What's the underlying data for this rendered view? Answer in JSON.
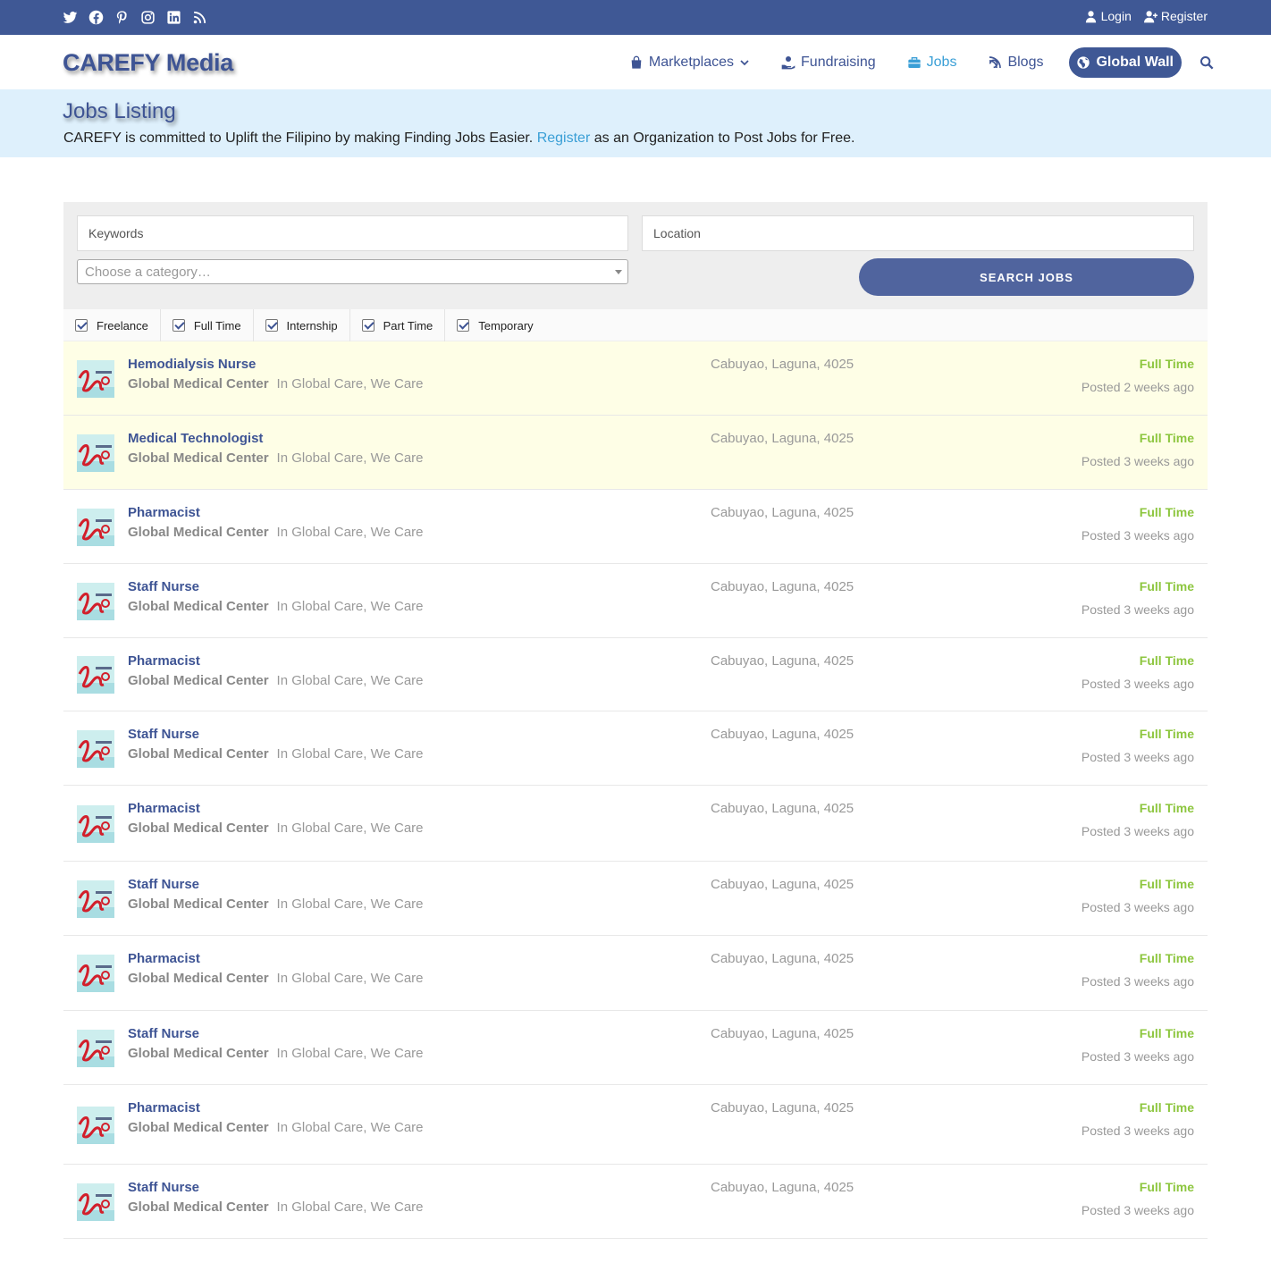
{
  "topbar": {
    "social": [
      "twitter-icon",
      "facebook-icon",
      "pinterest-icon",
      "instagram-icon",
      "linkedin-icon",
      "rss-icon"
    ],
    "login": "Login",
    "register": "Register"
  },
  "header": {
    "logo": "CAREFY Media",
    "nav": {
      "marketplaces": "Marketplaces",
      "fundraising": "Fundraising",
      "jobs": "Jobs",
      "blogs": "Blogs",
      "global_wall": "Global Wall"
    }
  },
  "banner": {
    "title": "Jobs Listing",
    "text_before": "CAREFY is committed to Uplift the Filipino by making Finding Jobs Easier. ",
    "link": "Register",
    "text_after": " as an Organization to Post Jobs for Free."
  },
  "search": {
    "keywords_placeholder": "Keywords",
    "location_placeholder": "Location",
    "category_placeholder": "Choose a category…",
    "button": "SEARCH JOBS"
  },
  "job_types": [
    "Freelance",
    "Full Time",
    "Internship",
    "Part Time",
    "Temporary"
  ],
  "colors": {
    "brand": "#3f5895",
    "accent": "#3a9fd6",
    "fulltime": "#8dc63f",
    "featured_bg": "#fefee6"
  },
  "jobs": [
    {
      "title": "Hemodialysis Nurse",
      "company": "Global Medical Center",
      "tagline": "In Global Care, We Care",
      "location": "Cabuyao, Laguna, 4025",
      "type": "Full Time",
      "posted": "Posted 2 weeks ago",
      "featured": true
    },
    {
      "title": "Medical Technologist",
      "company": "Global Medical Center",
      "tagline": "In Global Care, We Care",
      "location": "Cabuyao, Laguna, 4025",
      "type": "Full Time",
      "posted": "Posted 3 weeks ago",
      "featured": true
    },
    {
      "title": "Pharmacist",
      "company": "Global Medical Center",
      "tagline": "In Global Care, We Care",
      "location": "Cabuyao, Laguna, 4025",
      "type": "Full Time",
      "posted": "Posted 3 weeks ago",
      "featured": false
    },
    {
      "title": "Staff Nurse",
      "company": "Global Medical Center",
      "tagline": "In Global Care, We Care",
      "location": "Cabuyao, Laguna, 4025",
      "type": "Full Time",
      "posted": "Posted 3 weeks ago",
      "featured": false
    },
    {
      "title": "Pharmacist",
      "company": "Global Medical Center",
      "tagline": "In Global Care, We Care",
      "location": "Cabuyao, Laguna, 4025",
      "type": "Full Time",
      "posted": "Posted 3 weeks ago",
      "featured": false
    },
    {
      "title": "Staff Nurse",
      "company": "Global Medical Center",
      "tagline": "In Global Care, We Care",
      "location": "Cabuyao, Laguna, 4025",
      "type": "Full Time",
      "posted": "Posted 3 weeks ago",
      "featured": false
    },
    {
      "title": "Pharmacist",
      "company": "Global Medical Center",
      "tagline": "In Global Care, We Care",
      "location": "Cabuyao, Laguna, 4025",
      "type": "Full Time",
      "posted": "Posted 3 weeks ago",
      "featured": false
    },
    {
      "title": "Staff Nurse",
      "company": "Global Medical Center",
      "tagline": "In Global Care, We Care",
      "location": "Cabuyao, Laguna, 4025",
      "type": "Full Time",
      "posted": "Posted 3 weeks ago",
      "featured": false
    },
    {
      "title": "Pharmacist",
      "company": "Global Medical Center",
      "tagline": "In Global Care, We Care",
      "location": "Cabuyao, Laguna, 4025",
      "type": "Full Time",
      "posted": "Posted 3 weeks ago",
      "featured": false
    },
    {
      "title": "Staff Nurse",
      "company": "Global Medical Center",
      "tagline": "In Global Care, We Care",
      "location": "Cabuyao, Laguna, 4025",
      "type": "Full Time",
      "posted": "Posted 3 weeks ago",
      "featured": false
    },
    {
      "title": "Pharmacist",
      "company": "Global Medical Center",
      "tagline": "In Global Care, We Care",
      "location": "Cabuyao, Laguna, 4025",
      "type": "Full Time",
      "posted": "Posted 3 weeks ago",
      "featured": false
    },
    {
      "title": "Staff Nurse",
      "company": "Global Medical Center",
      "tagline": "In Global Care, We Care",
      "location": "Cabuyao, Laguna, 4025",
      "type": "Full Time",
      "posted": "Posted 3 weeks ago",
      "featured": false
    }
  ]
}
